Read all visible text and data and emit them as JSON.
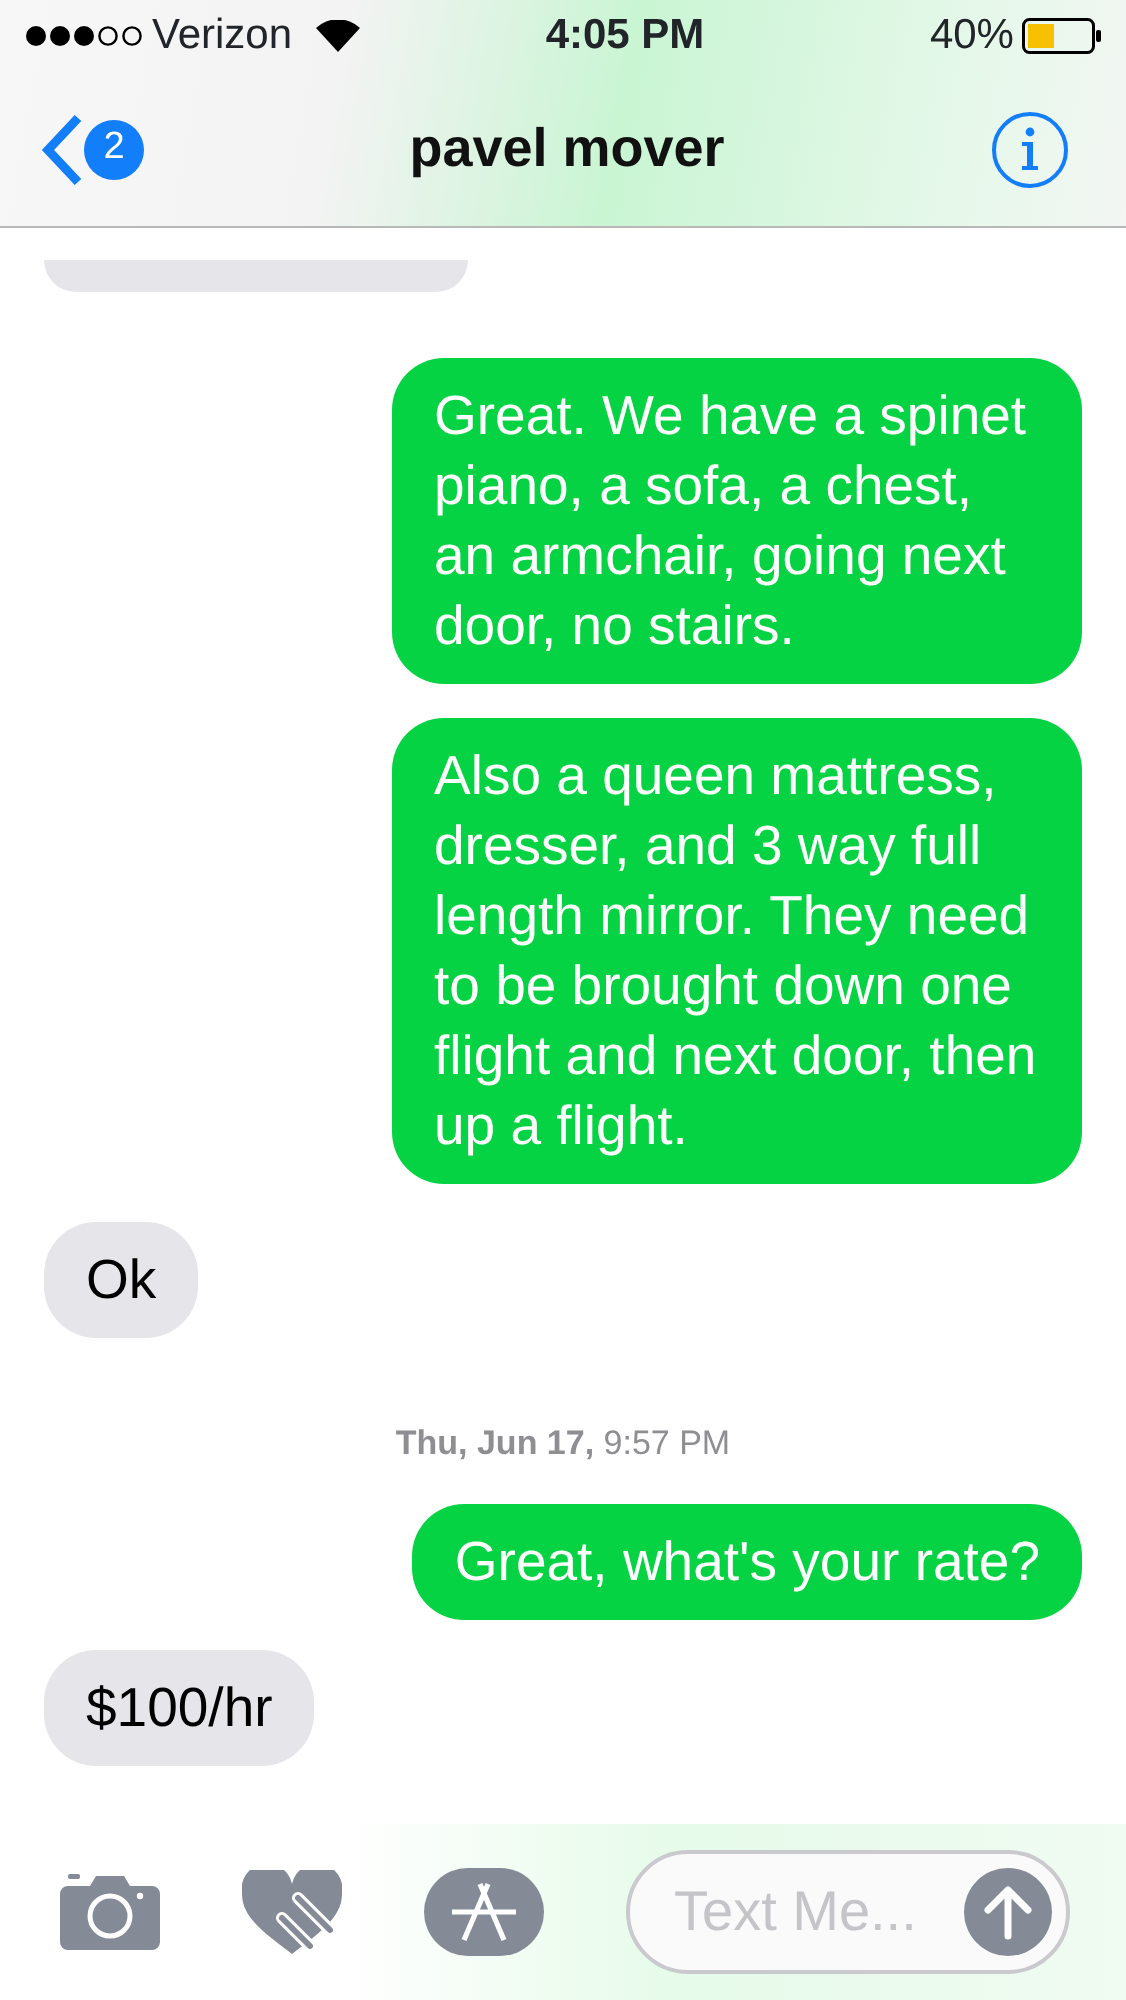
{
  "status_bar": {
    "carrier": "Verizon",
    "time": "4:05 PM",
    "battery": "40%"
  },
  "nav": {
    "back_badge": "2",
    "title": "pavel mover"
  },
  "messages": [
    {
      "kind": "clipped",
      "outgoing": false
    },
    {
      "kind": "text",
      "outgoing": true,
      "text": "Great. We have a spinet piano, a sofa, a chest, an armchair, going next door, no stairs."
    },
    {
      "kind": "text",
      "outgoing": true,
      "text": "Also a queen mattress, dresser, and 3 way full length mirror. They need to be brought down one flight and next door, then up a flight."
    },
    {
      "kind": "text",
      "outgoing": false,
      "text": "Ok"
    },
    {
      "kind": "timestamp",
      "text": "**Thu, Jun 17,** 9:57 PM"
    },
    {
      "kind": "text",
      "outgoing": true,
      "text": "Great, what's your rate?"
    },
    {
      "kind": "text",
      "outgoing": false,
      "text": "$100/hr"
    }
  ],
  "composer": {
    "placeholder": "Text Me..."
  }
}
